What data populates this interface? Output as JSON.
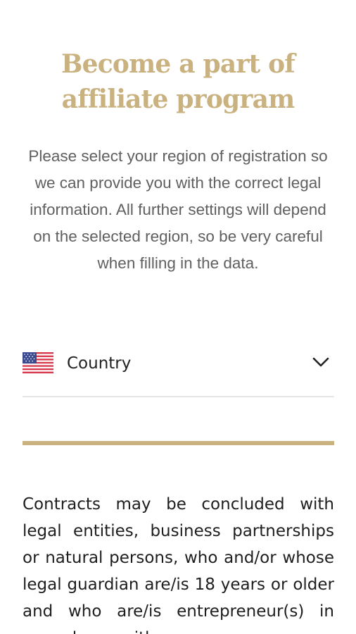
{
  "header": {
    "title": "Become a part of affiliate program"
  },
  "intro": {
    "text": "Please select your region of registration so we can provide you with the correct legal information. All further settings will depend on the selected region, so be very careful when filling in the data."
  },
  "country_select": {
    "value": "Country",
    "flag_icon": "us-flag-icon",
    "chevron_icon": "chevron-down-icon"
  },
  "legal": {
    "text": "Contracts may be concluded with legal entities, business partnerships or natural persons, who and/or whose legal guardian are/is 18 years or older and who are/is entrepreneur(s) in accordance with"
  },
  "colors": {
    "accent_gold": "#c9b27f",
    "body_text": "#1e1e1e",
    "muted_text": "#5f5f5f",
    "field_border": "#e6e6e6"
  }
}
